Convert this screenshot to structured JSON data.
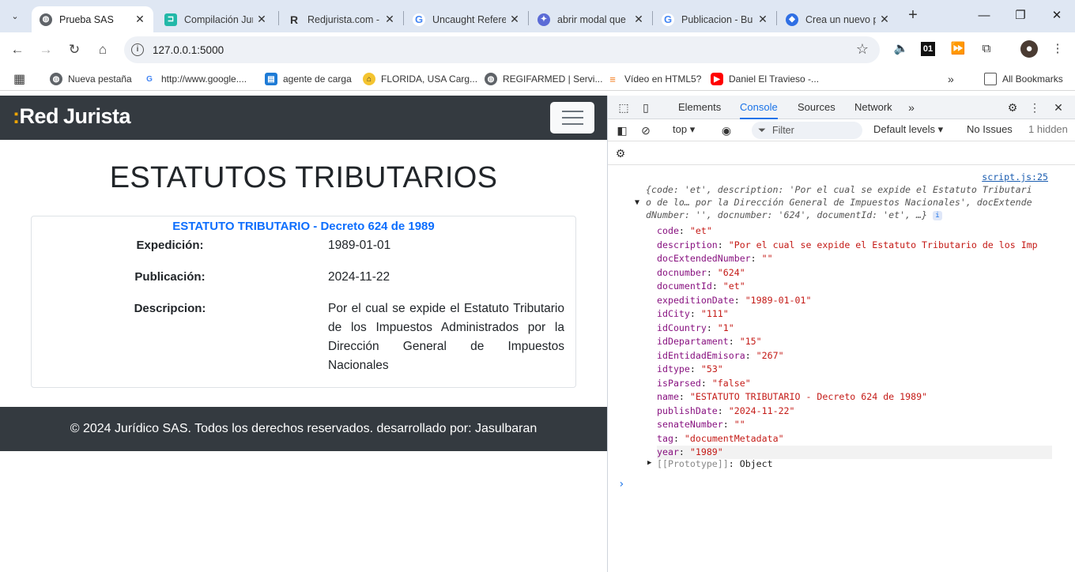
{
  "browser": {
    "tabs": [
      {
        "title": "Prueba SAS",
        "icon": "globe-icon",
        "active": true
      },
      {
        "title": "Compilación Juri",
        "icon": "compilacion-icon"
      },
      {
        "title": "Redjurista.com -",
        "icon": "redjurista-icon"
      },
      {
        "title": "Uncaught Refere",
        "icon": "google-icon"
      },
      {
        "title": "abrir modal que",
        "icon": "ai-icon"
      },
      {
        "title": "Publicacion - Bu",
        "icon": "google-icon"
      },
      {
        "title": "Crea un nuevo p",
        "icon": "gemini-icon"
      }
    ],
    "url": "127.0.0.1:5000",
    "bookmarks": [
      {
        "label": "Nueva pestaña",
        "icon": "globe-icon"
      },
      {
        "label": "http://www.google....",
        "icon": "google-icon"
      },
      {
        "label": "agente de carga",
        "icon": "agente-icon"
      },
      {
        "label": "FLORIDA, USA Carg...",
        "icon": "florida-icon"
      },
      {
        "label": "REGIFARMED | Servi...",
        "icon": "globe-icon"
      },
      {
        "label": "Vídeo en HTML5?",
        "icon": "stack-icon"
      },
      {
        "label": "Daniel El Travieso -...",
        "icon": "youtube-icon"
      }
    ],
    "all_bookmarks": "All Bookmarks"
  },
  "site": {
    "logo_prefix": "Red",
    "logo_suffix": "Jurista",
    "page_title": "ESTATUTOS TRIBUTARIOS",
    "card": {
      "title": "ESTATUTO TRIBUTARIO - Decreto 624 de 1989",
      "expedicion_label": "Expedición:",
      "expedicion_value": "1989-01-01",
      "publicacion_label": "Publicación:",
      "publicacion_value": "2024-11-22",
      "descripcion_label": "Descripcion:",
      "descripcion_value": "Por el cual se expide el Estatuto Tributario de los Impuestos Administrados por la Dirección General de Impuestos Nacionales"
    },
    "footer": "© 2024 Jurídico SAS. Todos los derechos reservados. desarrollado por: Jasulbaran"
  },
  "devtools": {
    "tabs": [
      "Elements",
      "Console",
      "Sources",
      "Network"
    ],
    "active_tab": "Console",
    "context": "top",
    "filter_placeholder": "Filter",
    "levels": "Default levels",
    "issues": "No Issues",
    "hidden": "1 hidden",
    "source_link": "script.js:25",
    "summary_line1": "{code: 'et', description: 'Por el cual se expide el Estatuto Tributari",
    "summary_line2": "o de lo… por la Dirección General de Impuestos Nacionales', docExtende",
    "summary_line3": "dNumber: '', docnumber: '624', documentId: 'et', …}",
    "properties": [
      {
        "key": "code",
        "value": "\"et\""
      },
      {
        "key": "description",
        "value": "\"Por el cual se expide el Estatuto Tributario de los Imp"
      },
      {
        "key": "docExtendedNumber",
        "value": "\"\""
      },
      {
        "key": "docnumber",
        "value": "\"624\""
      },
      {
        "key": "documentId",
        "value": "\"et\""
      },
      {
        "key": "expeditionDate",
        "value": "\"1989-01-01\""
      },
      {
        "key": "idCity",
        "value": "\"111\""
      },
      {
        "key": "idCountry",
        "value": "\"1\""
      },
      {
        "key": "idDepartament",
        "value": "\"15\""
      },
      {
        "key": "idEntidadEmisora",
        "value": "\"267\""
      },
      {
        "key": "idtype",
        "value": "\"53\""
      },
      {
        "key": "isParsed",
        "value": "\"false\""
      },
      {
        "key": "name",
        "value": "\"ESTATUTO TRIBUTARIO - Decreto 624 de 1989\""
      },
      {
        "key": "publishDate",
        "value": "\"2024-11-22\""
      },
      {
        "key": "senateNumber",
        "value": "\"\""
      },
      {
        "key": "tag",
        "value": "\"documentMetadata\""
      },
      {
        "key": "year",
        "value": "\"1989\""
      }
    ],
    "prototype_label": "[[Prototype]]",
    "prototype_value": "Object"
  }
}
